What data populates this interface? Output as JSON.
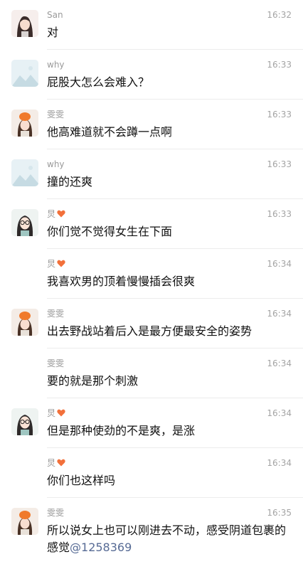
{
  "messages": [
    {
      "name": "San",
      "time": "16:32",
      "text": "对"
    },
    {
      "name": "why",
      "time": "16:33",
      "text": "屁股大怎么会难入？"
    },
    {
      "name": "雯雯",
      "time": "16:33",
      "text": "他高难道就不会蹲一点啊"
    },
    {
      "name": "why",
      "time": "16:33",
      "text": "撞的还爽"
    },
    {
      "name": "炅",
      "time": "16:33",
      "text": "你们觉不觉得女生在下面"
    },
    {
      "name": "炅",
      "time": "16:34",
      "text": "我喜欢男的顶着慢慢插会很爽"
    },
    {
      "name": "雯雯",
      "time": "16:34",
      "text": "出去野战站着后入是最方便最安全的姿势"
    },
    {
      "name": "雯雯",
      "time": "16:34",
      "text": "要的就是那个刺激"
    },
    {
      "name": "炅",
      "time": "16:34",
      "text": "但是那种使劲的不是爽，是涨"
    },
    {
      "name": "炅",
      "time": "16:34",
      "text": "你们也这样吗"
    },
    {
      "name": "雯雯",
      "time": "16:35",
      "text": "所以说女上也可以刚进去不动，感受阴道包裹的感觉",
      "mention": "@1258369"
    }
  ],
  "colors": {
    "name": "#9a9a9a",
    "time": "#a4a4a4",
    "text": "#111111",
    "mention": "#576b95",
    "heart": "#f2703a"
  }
}
